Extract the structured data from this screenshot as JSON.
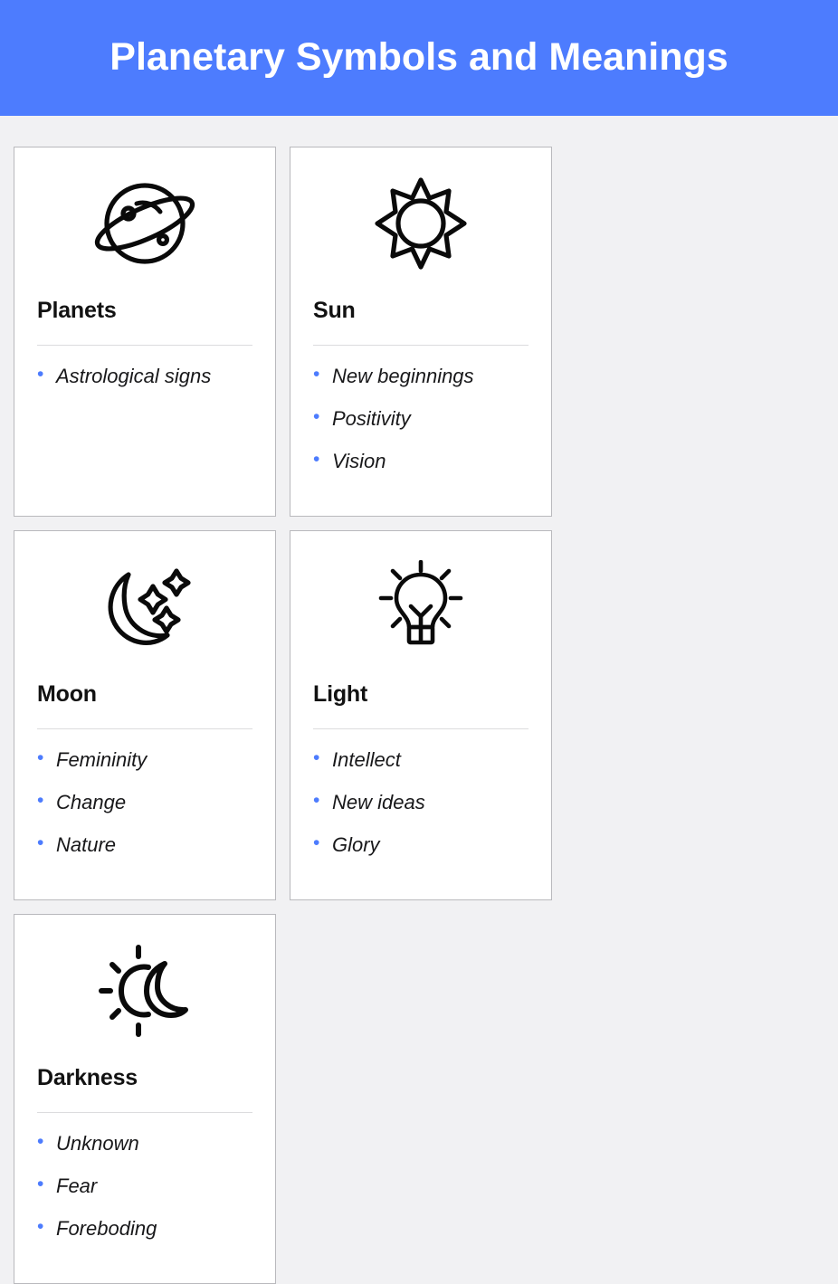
{
  "header": {
    "title": "Planetary Symbols and Meanings",
    "background_color": "#4d7cfe",
    "text_color": "#ffffff"
  },
  "theme": {
    "page_background": "#f1f1f3",
    "card_background": "#ffffff",
    "card_border": "#b9b9bd",
    "accent": "#4d7cfe",
    "divider": "#dcdcde",
    "title_text": "#121212",
    "body_text": "#18181a"
  },
  "cards": [
    {
      "icon": "planet-saturn-icon",
      "title": "Planets",
      "bullets": [
        "Astrological signs"
      ]
    },
    {
      "icon": "sun-burst-icon",
      "title": "Sun",
      "bullets": [
        "New beginnings",
        "Positivity",
        "Vision"
      ]
    },
    {
      "icon": "crescent-moon-stars-icon",
      "title": "Moon",
      "bullets": [
        "Femininity",
        "Change",
        "Nature"
      ]
    },
    {
      "icon": "lightbulb-icon",
      "title": "Light",
      "bullets": [
        "Intellect",
        "New ideas",
        "Glory"
      ]
    },
    {
      "icon": "eclipse-sun-moon-icon",
      "title": "Darkness",
      "bullets": [
        "Unknown",
        "Fear",
        "Foreboding"
      ]
    }
  ],
  "bullet_marker": "•"
}
